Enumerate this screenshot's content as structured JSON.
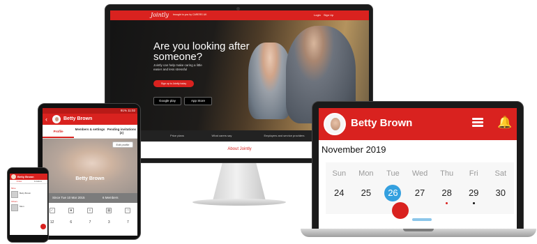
{
  "monitor": {
    "logo": "Jointly",
    "brought_by": "brought to you by CARERS UK",
    "login": "Login",
    "signup": "Sign Up",
    "headline": "Are you looking after someone?",
    "subtext": "Jointly can help make caring a little easier and less stressful",
    "cta": "Sign up to Jointly today",
    "google_play": "Google play",
    "app_store": "App Store",
    "tabs": [
      "About Jointly",
      "Price plans",
      "What carers say",
      "Employers and service providers",
      ""
    ],
    "about_title": "About Jointly"
  },
  "tablet": {
    "status": "91% 11:02",
    "name": "Betty Brown",
    "tabs": [
      {
        "label": "Profile"
      },
      {
        "label": "Members & settings"
      },
      {
        "label": "Pending invitations (2)"
      }
    ],
    "edit_label": "Edit profile",
    "profile_name": "Betty Brown",
    "since": "Since Tue 10 Mar 2015",
    "members": "6 Members",
    "counts": [
      "12",
      "6",
      "7",
      "3",
      "7"
    ]
  },
  "phone": {
    "name": "Betty Brown",
    "tabs": [
      "Circles",
      "Invitations"
    ],
    "section1": "Mine",
    "items": [
      "Betty Brown",
      "Mum"
    ],
    "section2": "Others"
  },
  "laptop": {
    "name": "Betty Brown",
    "month": "November 2019",
    "days": [
      "Sun",
      "Mon",
      "Tue",
      "Wed",
      "Thu",
      "Fri",
      "Sat"
    ],
    "dates": [
      "24",
      "25",
      "26",
      "27",
      "28",
      "29",
      "30"
    ],
    "selected_index": 2,
    "dots": [
      null,
      null,
      "#d9221f",
      null,
      "#d9221f",
      "#111111",
      null
    ],
    "accent": "#d9221f",
    "selected_color": "#34a0df"
  }
}
